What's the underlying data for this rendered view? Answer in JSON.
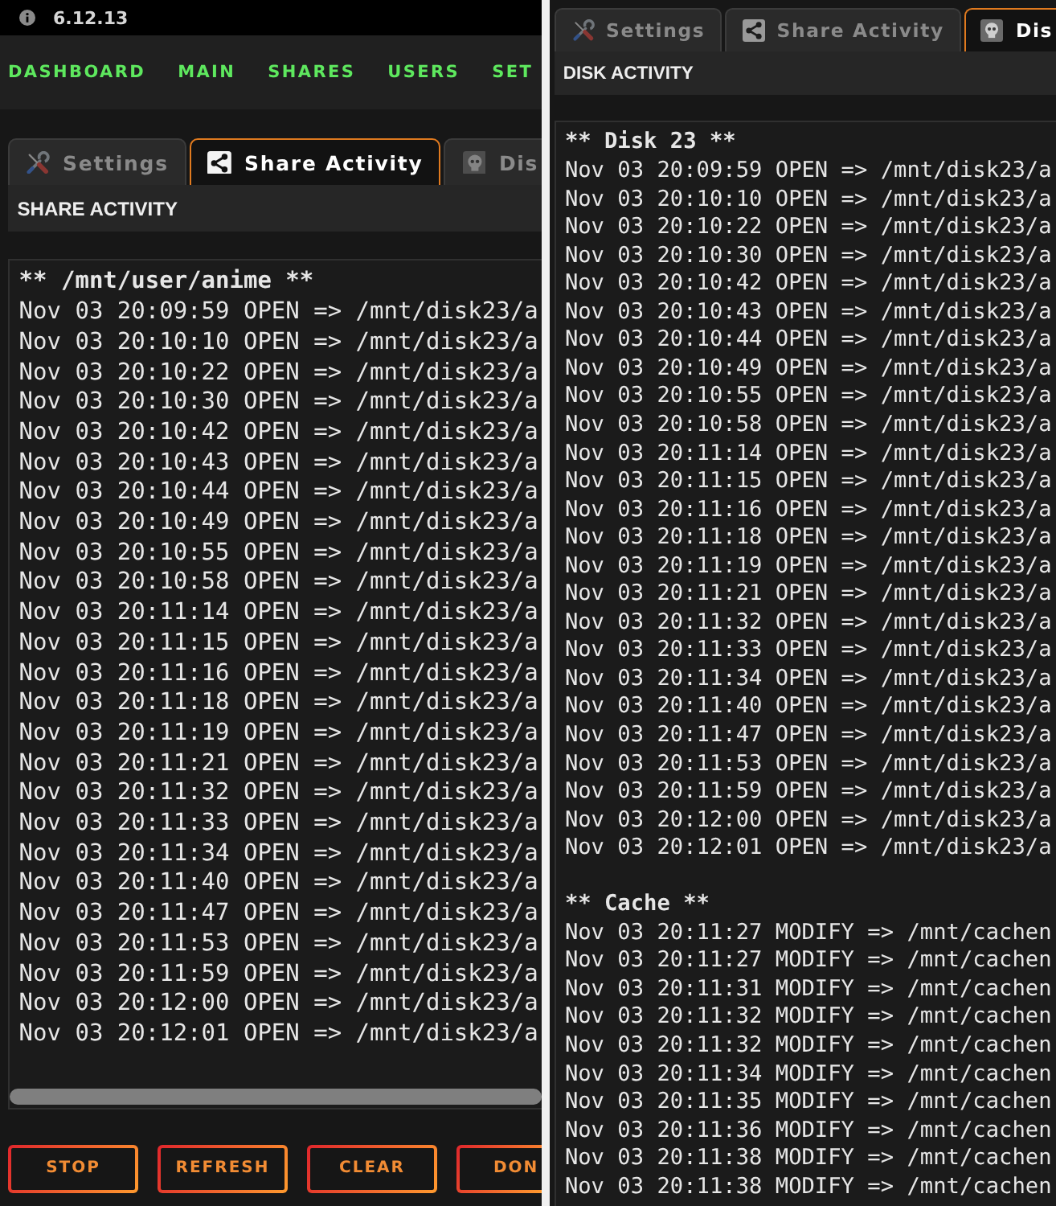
{
  "panels": [
    {
      "version": "6.12.13",
      "nav": [
        "DASHBOARD",
        "MAIN",
        "SHARES",
        "USERS",
        "SET"
      ],
      "tabs": [
        {
          "label": "Settings",
          "kind": "settings",
          "selected": false
        },
        {
          "label": "Share Activity",
          "kind": "share",
          "selected": true
        },
        {
          "label": "Dis",
          "kind": "disk",
          "selected": false
        }
      ],
      "title": "SHARE ACTIVITY",
      "log": [
        {
          "heading": "** /mnt/user/anime **",
          "lines": [
            "Nov 03 20:09:59 OPEN => /mnt/disk23/a",
            "Nov 03 20:10:10 OPEN => /mnt/disk23/a",
            "Nov 03 20:10:22 OPEN => /mnt/disk23/a",
            "Nov 03 20:10:30 OPEN => /mnt/disk23/a",
            "Nov 03 20:10:42 OPEN => /mnt/disk23/a",
            "Nov 03 20:10:43 OPEN => /mnt/disk23/a",
            "Nov 03 20:10:44 OPEN => /mnt/disk23/a",
            "Nov 03 20:10:49 OPEN => /mnt/disk23/a",
            "Nov 03 20:10:55 OPEN => /mnt/disk23/a",
            "Nov 03 20:10:58 OPEN => /mnt/disk23/a",
            "Nov 03 20:11:14 OPEN => /mnt/disk23/a",
            "Nov 03 20:11:15 OPEN => /mnt/disk23/a",
            "Nov 03 20:11:16 OPEN => /mnt/disk23/a",
            "Nov 03 20:11:18 OPEN => /mnt/disk23/a",
            "Nov 03 20:11:19 OPEN => /mnt/disk23/a",
            "Nov 03 20:11:21 OPEN => /mnt/disk23/a",
            "Nov 03 20:11:32 OPEN => /mnt/disk23/a",
            "Nov 03 20:11:33 OPEN => /mnt/disk23/a",
            "Nov 03 20:11:34 OPEN => /mnt/disk23/a",
            "Nov 03 20:11:40 OPEN => /mnt/disk23/a",
            "Nov 03 20:11:47 OPEN => /mnt/disk23/a",
            "Nov 03 20:11:53 OPEN => /mnt/disk23/a",
            "Nov 03 20:11:59 OPEN => /mnt/disk23/a",
            "Nov 03 20:12:00 OPEN => /mnt/disk23/a",
            "Nov 03 20:12:01 OPEN => /mnt/disk23/a"
          ]
        }
      ],
      "scrollbar": true,
      "buttons": [
        "STOP",
        "REFRESH",
        "CLEAR",
        "DON"
      ]
    },
    {
      "tabs": [
        {
          "label": "Settings",
          "kind": "settings",
          "selected": false
        },
        {
          "label": "Share Activity",
          "kind": "share",
          "selected": false
        },
        {
          "label": "Dis",
          "kind": "disk",
          "selected": true
        }
      ],
      "title": "DISK ACTIVITY",
      "log": [
        {
          "heading": "** Disk 23 **",
          "lines": [
            "Nov 03 20:09:59 OPEN => /mnt/disk23/a",
            "Nov 03 20:10:10 OPEN => /mnt/disk23/a",
            "Nov 03 20:10:22 OPEN => /mnt/disk23/a",
            "Nov 03 20:10:30 OPEN => /mnt/disk23/a",
            "Nov 03 20:10:42 OPEN => /mnt/disk23/a",
            "Nov 03 20:10:43 OPEN => /mnt/disk23/a",
            "Nov 03 20:10:44 OPEN => /mnt/disk23/a",
            "Nov 03 20:10:49 OPEN => /mnt/disk23/a",
            "Nov 03 20:10:55 OPEN => /mnt/disk23/a",
            "Nov 03 20:10:58 OPEN => /mnt/disk23/a",
            "Nov 03 20:11:14 OPEN => /mnt/disk23/a",
            "Nov 03 20:11:15 OPEN => /mnt/disk23/a",
            "Nov 03 20:11:16 OPEN => /mnt/disk23/a",
            "Nov 03 20:11:18 OPEN => /mnt/disk23/a",
            "Nov 03 20:11:19 OPEN => /mnt/disk23/a",
            "Nov 03 20:11:21 OPEN => /mnt/disk23/a",
            "Nov 03 20:11:32 OPEN => /mnt/disk23/a",
            "Nov 03 20:11:33 OPEN => /mnt/disk23/a",
            "Nov 03 20:11:34 OPEN => /mnt/disk23/a",
            "Nov 03 20:11:40 OPEN => /mnt/disk23/a",
            "Nov 03 20:11:47 OPEN => /mnt/disk23/a",
            "Nov 03 20:11:53 OPEN => /mnt/disk23/a",
            "Nov 03 20:11:59 OPEN => /mnt/disk23/a",
            "Nov 03 20:12:00 OPEN => /mnt/disk23/a",
            "Nov 03 20:12:01 OPEN => /mnt/disk23/a"
          ]
        },
        {
          "heading": "** Cache **",
          "lines": [
            "Nov 03 20:11:27 MODIFY => /mnt/cachen",
            "Nov 03 20:11:27 MODIFY => /mnt/cachen",
            "Nov 03 20:11:31 MODIFY => /mnt/cachen",
            "Nov 03 20:11:32 MODIFY => /mnt/cachen",
            "Nov 03 20:11:32 MODIFY => /mnt/cachen",
            "Nov 03 20:11:34 MODIFY => /mnt/cachen",
            "Nov 03 20:11:35 MODIFY => /mnt/cachen",
            "Nov 03 20:11:36 MODIFY => /mnt/cachen",
            "Nov 03 20:11:38 MODIFY => /mnt/cachen",
            "Nov 03 20:11:38 MODIFY => /mnt/cachen"
          ]
        }
      ]
    }
  ]
}
